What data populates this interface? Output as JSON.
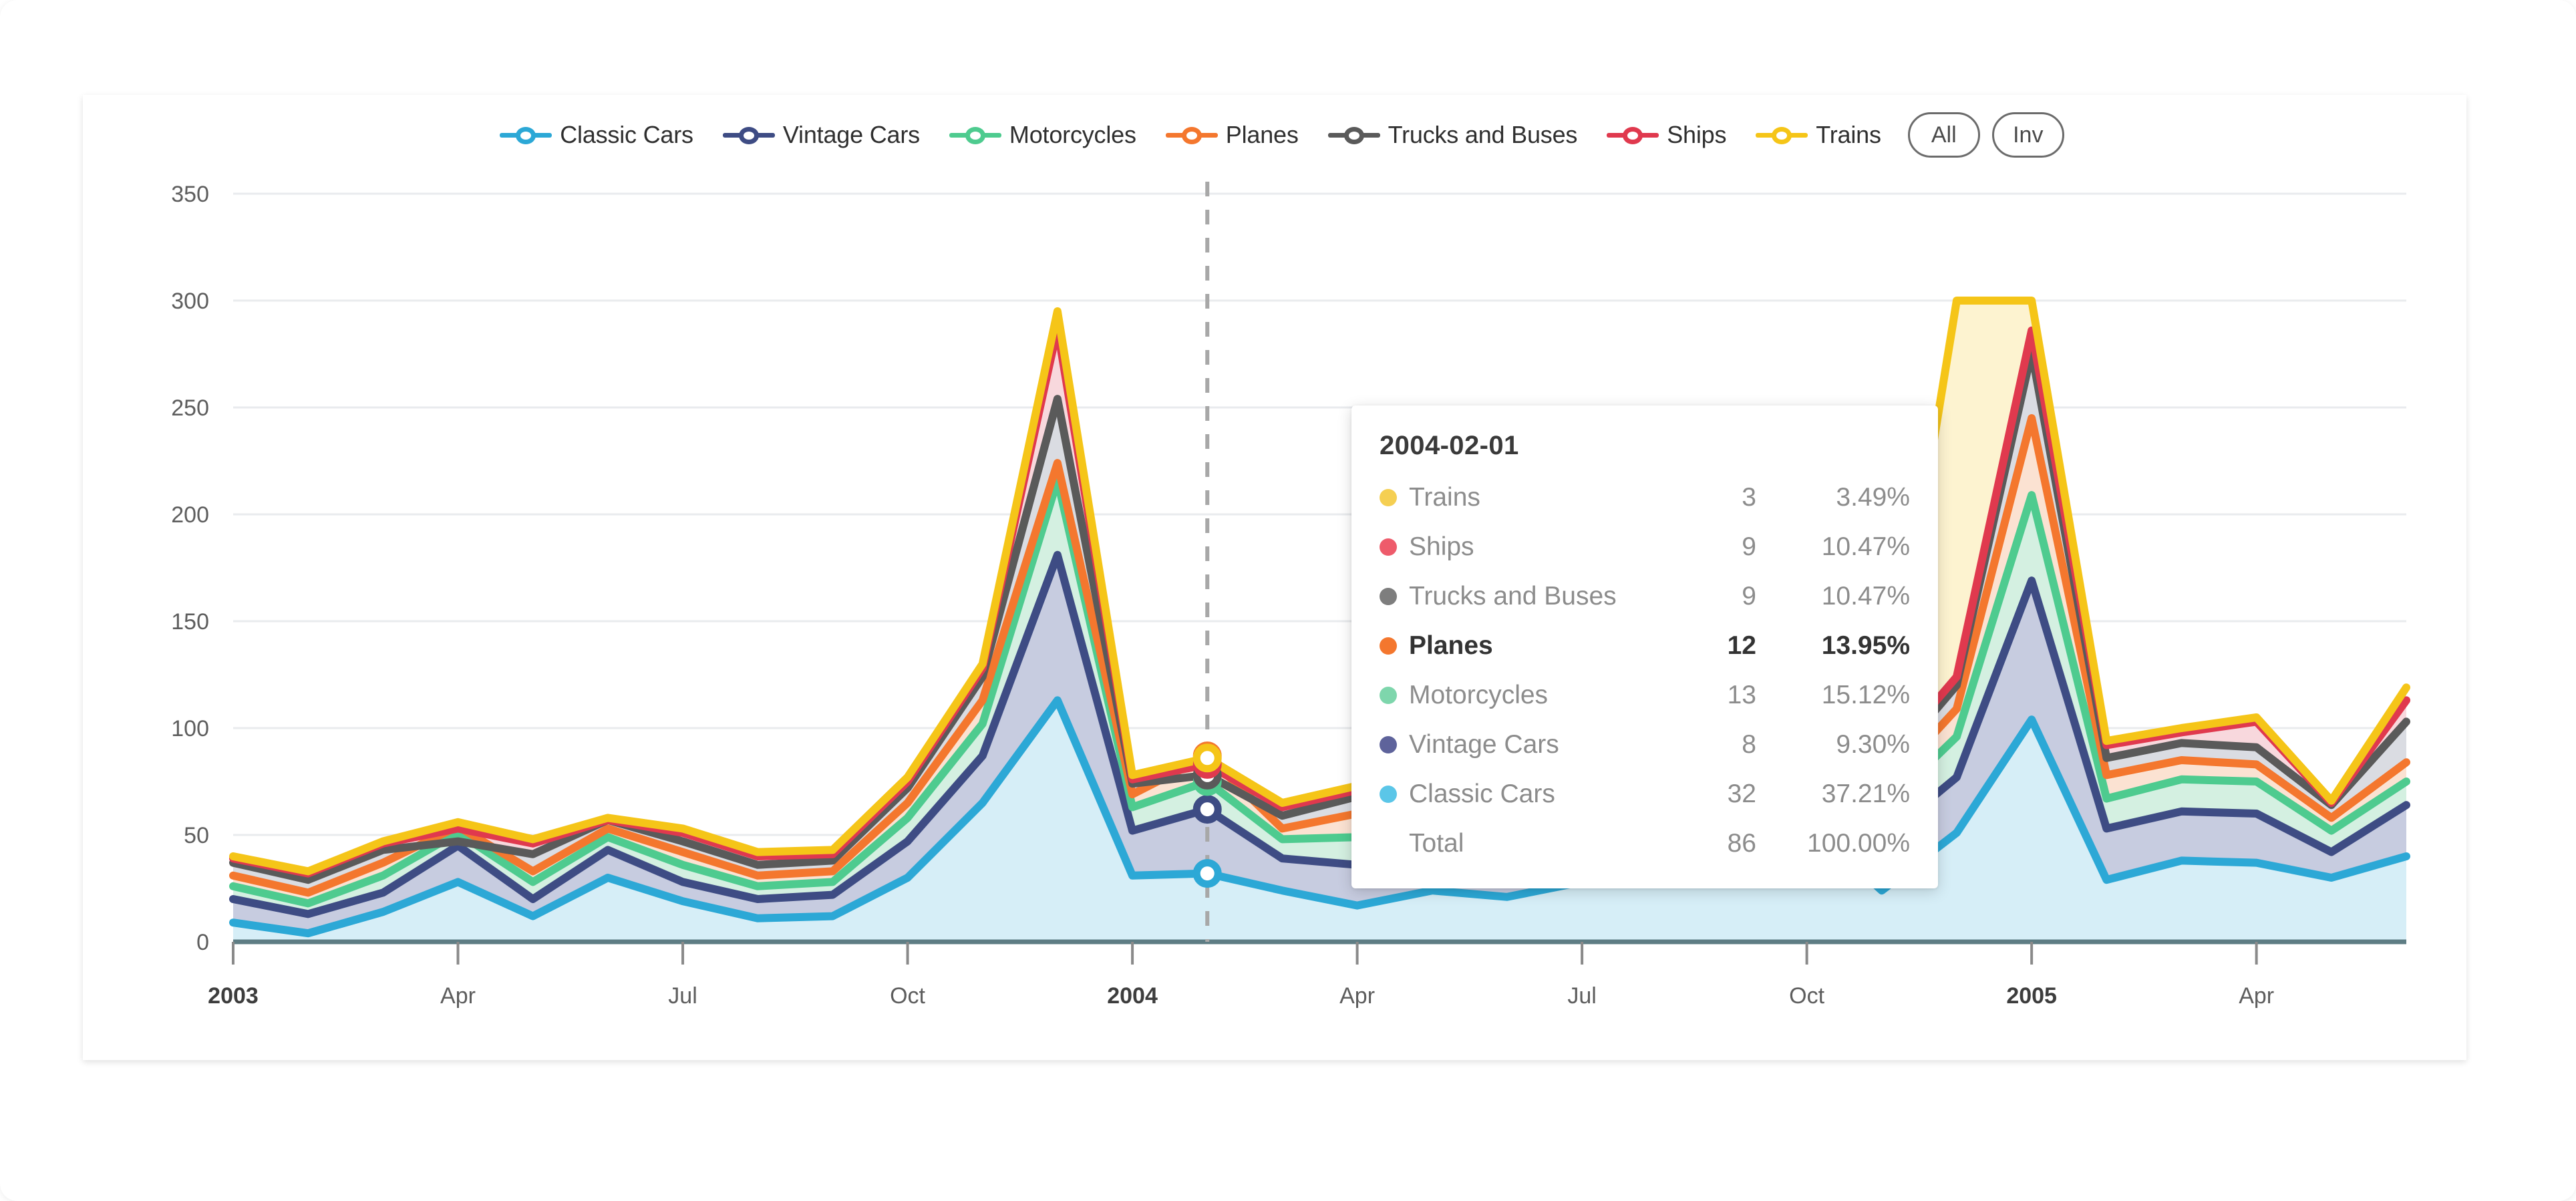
{
  "legend": {
    "items": [
      {
        "label": "Classic Cars",
        "color": "#2CA8D6",
        "key": "classic_cars"
      },
      {
        "label": "Vintage Cars",
        "color": "#3E4C84",
        "key": "vintage_cars"
      },
      {
        "label": "Motorcycles",
        "color": "#4ECB8F",
        "key": "motorcycles"
      },
      {
        "label": "Planes",
        "color": "#F4772E",
        "key": "planes"
      },
      {
        "label": "Trucks and Buses",
        "color": "#5A5A5A",
        "key": "trucks_and_buses"
      },
      {
        "label": "Ships",
        "color": "#E0394E",
        "key": "ships"
      },
      {
        "label": "Trains",
        "color": "#F5C518",
        "key": "trains"
      }
    ],
    "all_button": "All",
    "invert_button": "Inv"
  },
  "tooltip": {
    "title": "2004-02-01",
    "rows": [
      {
        "name": "Trains",
        "value": "3",
        "pct": "3.49%",
        "color": "#F5CF52",
        "bold": false
      },
      {
        "name": "Ships",
        "value": "9",
        "pct": "10.47%",
        "color": "#EE5B6B",
        "bold": false
      },
      {
        "name": "Trucks and Buses",
        "value": "9",
        "pct": "10.47%",
        "color": "#7E7E7E",
        "bold": false
      },
      {
        "name": "Planes",
        "value": "12",
        "pct": "13.95%",
        "color": "#F4772E",
        "bold": true
      },
      {
        "name": "Motorcycles",
        "value": "13",
        "pct": "15.12%",
        "color": "#7ED6AC",
        "bold": false
      },
      {
        "name": "Vintage Cars",
        "value": "8",
        "pct": "9.30%",
        "color": "#5E639B",
        "bold": false
      },
      {
        "name": "Classic Cars",
        "value": "32",
        "pct": "37.21%",
        "color": "#5BC6E8",
        "bold": false
      }
    ],
    "total_label": "Total",
    "total_value": "86",
    "total_pct": "100.00%"
  },
  "chart_data": {
    "type": "area",
    "stacked": true,
    "title": "",
    "xlabel": "",
    "ylabel": "",
    "ylim": [
      0,
      350
    ],
    "grid": true,
    "legend_position": "top",
    "y_ticks": [
      "0",
      "50",
      "100",
      "150",
      "200",
      "250",
      "300",
      "350"
    ],
    "x_tick_labels": [
      {
        "label": "2003",
        "bold": true,
        "index": 0
      },
      {
        "label": "Apr",
        "bold": false,
        "index": 3
      },
      {
        "label": "Jul",
        "bold": false,
        "index": 6
      },
      {
        "label": "Oct",
        "bold": false,
        "index": 9
      },
      {
        "label": "2004",
        "bold": true,
        "index": 12
      },
      {
        "label": "Apr",
        "bold": false,
        "index": 15
      },
      {
        "label": "Jul",
        "bold": false,
        "index": 18
      },
      {
        "label": "Oct",
        "bold": false,
        "index": 21
      },
      {
        "label": "2005",
        "bold": true,
        "index": 24
      },
      {
        "label": "Apr",
        "bold": false,
        "index": 27
      }
    ],
    "x": [
      "2003-01",
      "2003-02",
      "2003-03",
      "2003-04",
      "2003-05",
      "2003-06",
      "2003-07",
      "2003-08",
      "2003-09",
      "2003-10",
      "2003-11",
      "2003-12",
      "2004-01",
      "2004-02",
      "2004-03",
      "2004-04",
      "2004-05",
      "2004-06",
      "2004-07",
      "2004-08",
      "2004-09",
      "2004-10",
      "2004-11",
      "2004-12",
      "2005-01",
      "2005-02",
      "2005-03",
      "2005-04",
      "2005-05"
    ],
    "cursor_x": "2004-02",
    "series": [
      {
        "name": "Classic Cars",
        "color": "#2CA8D6",
        "fill": "#D6EEF7",
        "values": [
          9,
          4,
          14,
          28,
          12,
          30,
          19,
          11,
          12,
          30,
          65,
          113,
          31,
          32,
          24,
          17,
          24,
          21,
          28,
          37,
          44,
          56,
          24,
          51,
          104,
          29,
          38,
          37,
          30,
          40
        ]
      },
      {
        "name": "Vintage Cars",
        "color": "#3E4C84",
        "fill": "#C7CCE0",
        "values": [
          20,
          13,
          23,
          45,
          20,
          43,
          28,
          20,
          22,
          47,
          87,
          181,
          52,
          62,
          39,
          36,
          41,
          38,
          46,
          50,
          64,
          78,
          48,
          77,
          169,
          53,
          61,
          60,
          42,
          64
        ]
      },
      {
        "name": "Motorcycles",
        "color": "#4ECB8F",
        "fill": "#D4F0E1",
        "values": [
          26,
          18,
          31,
          51,
          28,
          49,
          36,
          26,
          28,
          58,
          102,
          216,
          63,
          75,
          48,
          49,
          53,
          50,
          61,
          67,
          83,
          98,
          62,
          96,
          209,
          67,
          76,
          75,
          52,
          75
        ]
      },
      {
        "name": "Planes",
        "color": "#F4772E",
        "fill": "#FBE2D2",
        "values": [
          31,
          23,
          37,
          54,
          33,
          53,
          42,
          31,
          33,
          65,
          113,
          224,
          69,
          87,
          53,
          60,
          64,
          61,
          71,
          77,
          91,
          108,
          71,
          109,
          245,
          78,
          85,
          83,
          58,
          84
        ]
      },
      {
        "name": "Trucks and Buses",
        "color": "#5A5A5A",
        "fill": "#DADCE2",
        "values": [
          37,
          29,
          43,
          47,
          41,
          57,
          47,
          36,
          38,
          72,
          124,
          254,
          74,
          78,
          59,
          68,
          72,
          69,
          78,
          85,
          99,
          117,
          79,
          120,
          276,
          86,
          93,
          91,
          64,
          103
        ]
      },
      {
        "name": "Ships",
        "color": "#E0394E",
        "fill": "#F8D8DD",
        "values": [
          39,
          32,
          46,
          53,
          46,
          57,
          51,
          40,
          41,
          75,
          128,
          287,
          76,
          83,
          63,
          71,
          75,
          73,
          82,
          89,
          103,
          121,
          83,
          124,
          286,
          92,
          98,
          103,
          65,
          113
        ]
      },
      {
        "name": "Trains",
        "color": "#F5C518",
        "fill": "#FDF3D0",
        "values": [
          40,
          33,
          47,
          56,
          48,
          58,
          53,
          42,
          43,
          77,
          130,
          295,
          78,
          86,
          65,
          73,
          77,
          75,
          84,
          91,
          105,
          123,
          85,
          300,
          300,
          94,
          100,
          105,
          66,
          119
        ]
      }
    ]
  }
}
